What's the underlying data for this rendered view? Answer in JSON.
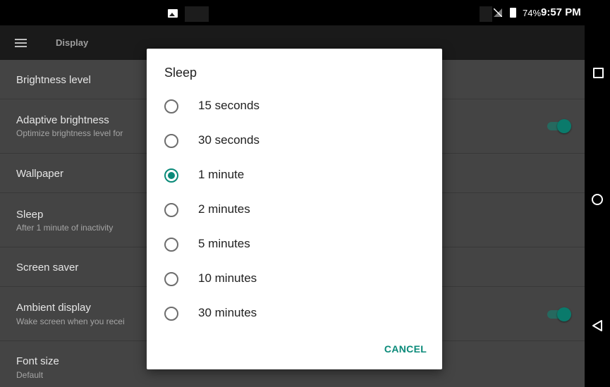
{
  "status_bar": {
    "battery_percent": "74%",
    "time": "9:57 PM"
  },
  "app_bar": {
    "title": "Display"
  },
  "settings": {
    "brightness": {
      "title": "Brightness level"
    },
    "adaptive": {
      "title": "Adaptive brightness",
      "subtitle": "Optimize brightness level for",
      "enabled": true
    },
    "wallpaper": {
      "title": "Wallpaper"
    },
    "sleep": {
      "title": "Sleep",
      "subtitle": "After 1 minute of inactivity"
    },
    "screensaver": {
      "title": "Screen saver"
    },
    "ambient": {
      "title": "Ambient display",
      "subtitle": "Wake screen when you recei",
      "enabled": true
    },
    "fontsize": {
      "title": "Font size",
      "subtitle": "Default"
    }
  },
  "dialog": {
    "title": "Sleep",
    "options": [
      {
        "label": "15 seconds",
        "checked": false
      },
      {
        "label": "30 seconds",
        "checked": false
      },
      {
        "label": "1 minute",
        "checked": true
      },
      {
        "label": "2 minutes",
        "checked": false
      },
      {
        "label": "5 minutes",
        "checked": false
      },
      {
        "label": "10 minutes",
        "checked": false
      },
      {
        "label": "30 minutes",
        "checked": false
      }
    ],
    "cancel_label": "CANCEL"
  },
  "colors": {
    "accent": "#0a8a79",
    "list_background": "#444444",
    "app_bar": "#1a1a1a"
  }
}
